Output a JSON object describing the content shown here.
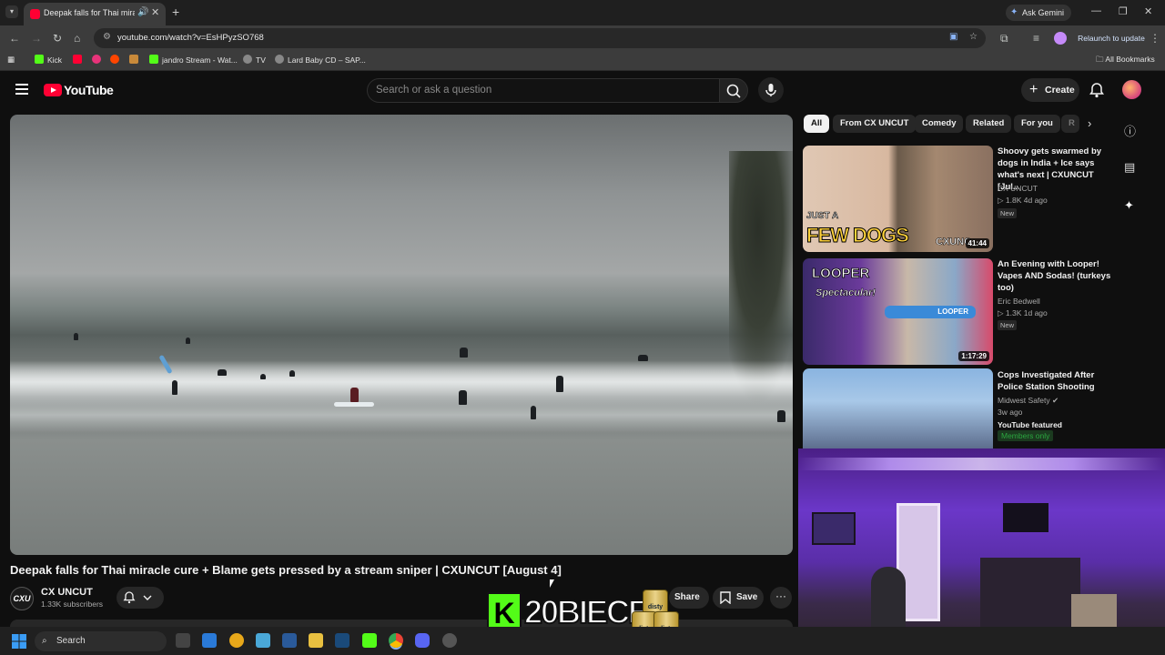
{
  "browser": {
    "tab_title": "Deepak falls for Thai miracle",
    "url": "youtube.com/watch?v=EsHPyzSO768",
    "ask_gemini": "Ask Gemini",
    "relaunch": "Relaunch to update",
    "all_bookmarks": "All Bookmarks",
    "bookmarks": [
      "Kick",
      "jandro Stream - Wat...",
      "TV",
      "Lard Baby CD – SAP..."
    ]
  },
  "youtube": {
    "logo_text": "YouTube",
    "search_placeholder": "Search or ask a question",
    "create_label": "Create"
  },
  "video": {
    "title": "Deepak falls for Thai miracle cure + Blame gets pressed by a stream sniper | CXUNCUT [August 4]",
    "channel_name": "CX UNCUT",
    "channel_avatar_text": "CXU",
    "subscribers": "1.33K subscribers",
    "share_label": "Share",
    "save_label": "Save"
  },
  "chips": [
    "All",
    "From CX UNCUT",
    "Comedy",
    "Related",
    "For you",
    "R"
  ],
  "recommendations": [
    {
      "title": "Shoovy gets swarmed by dogs in India + Ice says what's next | CXUNCUT [Jul...",
      "channel": "CX UNCUT",
      "meta": "1.8K  4d ago",
      "badge": "New",
      "duration": "41:44",
      "thumb_text_1": "JUST A",
      "thumb_text_2": "FEW DOGS",
      "thumb_text_3": "CXUNC"
    },
    {
      "title": "An Evening with Looper! Vapes AND Sodas! (turkeys too)",
      "channel": "Eric Bedwell",
      "meta": "1.3K  1d ago",
      "badge": "New",
      "duration": "1:17:29",
      "thumb_text_1": "LOOPER",
      "thumb_text_2": "Spectacular!",
      "thumb_text_3": "LOOPER"
    },
    {
      "title": "Cops Investigated After Police Station Shooting",
      "channel": "Midwest Safety",
      "meta": "3w ago",
      "badge": "YouTube featured",
      "badge2": "Members only"
    }
  ],
  "overlay": {
    "kick_letter": "K",
    "streamer": "20BIECE",
    "can_label": "disty"
  },
  "taskbar": {
    "search_label": "Search"
  },
  "colors": {
    "yt_red": "#ff0033",
    "kick_green": "#53fc18",
    "members_green": "#2ba640"
  }
}
